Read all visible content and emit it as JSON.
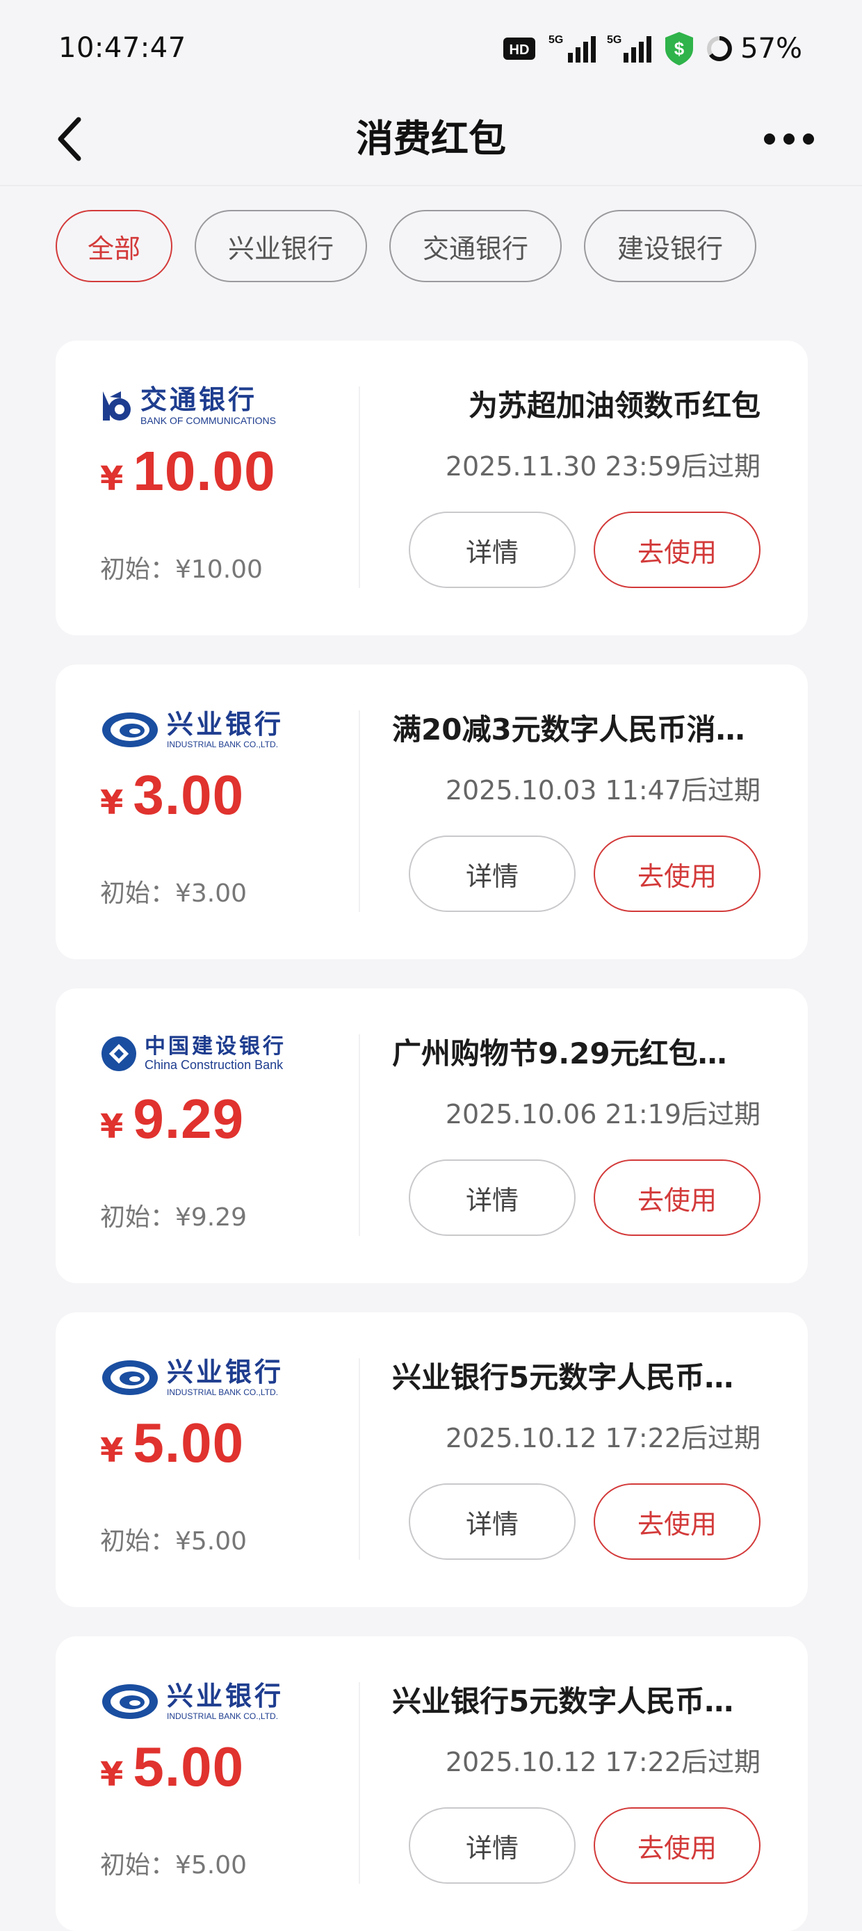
{
  "status_bar": {
    "time": "10:47:47",
    "battery": "57%",
    "net_label_1": "5G",
    "net_label_2": "5G",
    "hd_label": "HD"
  },
  "header": {
    "title": "消费红包"
  },
  "filters": [
    {
      "label": "全部",
      "active": true
    },
    {
      "label": "兴业银行",
      "active": false
    },
    {
      "label": "交通银行",
      "active": false
    },
    {
      "label": "建设银行",
      "active": false
    }
  ],
  "coupons": [
    {
      "bank_cn": "交通银行",
      "bank_en": "BANK OF COMMUNICATIONS",
      "currency": "¥",
      "amount": "10.00",
      "initial": "初始：¥10.00",
      "title": "为苏超加油领数币红包",
      "expiry": "2025.11.30 23:59后过期",
      "detail_label": "详情",
      "use_label": "去使用"
    },
    {
      "bank_cn": "兴业银行",
      "bank_en": "INDUSTRIAL BANK CO.,LTD.",
      "currency": "¥",
      "amount": "3.00",
      "initial": "初始：¥3.00",
      "title": "满20减3元数字人民币消…",
      "expiry": "2025.10.03 11:47后过期",
      "detail_label": "详情",
      "use_label": "去使用"
    },
    {
      "bank_cn": "中国建设银行",
      "bank_en": "China Construction Bank",
      "currency": "¥",
      "amount": "9.29",
      "initial": "初始：¥9.29",
      "title": "广州购物节9.29元红包…",
      "expiry": "2025.10.06 21:19后过期",
      "detail_label": "详情",
      "use_label": "去使用"
    },
    {
      "bank_cn": "兴业银行",
      "bank_en": "INDUSTRIAL BANK CO.,LTD.",
      "currency": "¥",
      "amount": "5.00",
      "initial": "初始：¥5.00",
      "title": "兴业银行5元数字人民币…",
      "expiry": "2025.10.12 17:22后过期",
      "detail_label": "详情",
      "use_label": "去使用"
    },
    {
      "bank_cn": "兴业银行",
      "bank_en": "INDUSTRIAL BANK CO.,LTD.",
      "currency": "¥",
      "amount": "5.00",
      "initial": "初始：¥5.00",
      "title": "兴业银行5元数字人民币…",
      "expiry": "2025.10.12 17:22后过期",
      "detail_label": "详情",
      "use_label": "去使用"
    }
  ],
  "colors": {
    "accent_red": "#e0322e",
    "bank_blue": "#1e3d8f",
    "page_bg": "#f5f5f7"
  }
}
